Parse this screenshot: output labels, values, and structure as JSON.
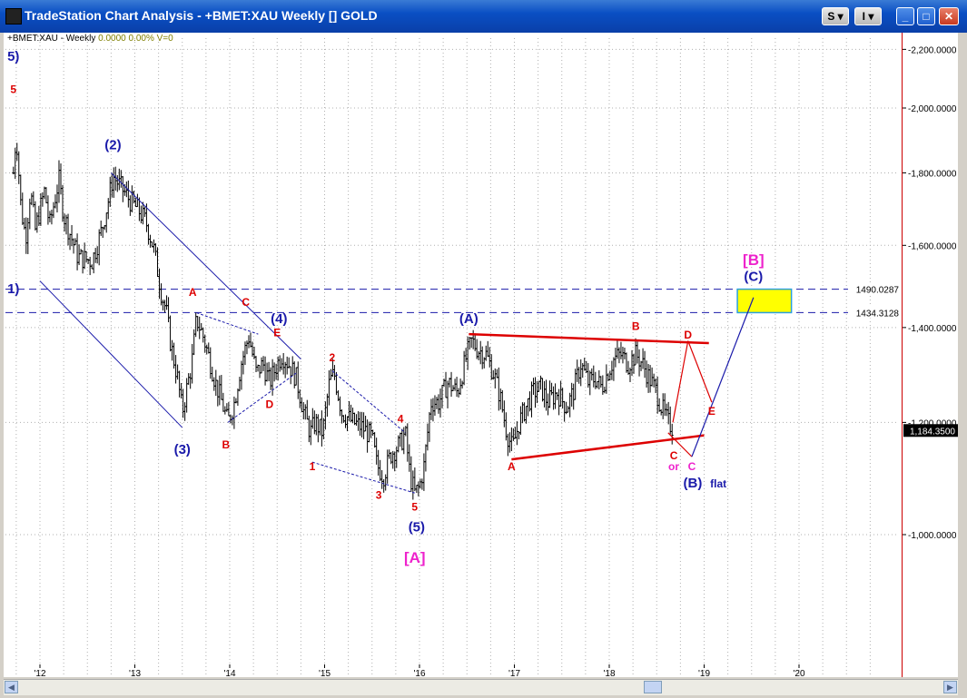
{
  "window": {
    "title": "TradeStation Chart Analysis - +BMET:XAU Weekly [] GOLD",
    "btn_s": "S",
    "btn_i": "I",
    "btn_min": "_",
    "btn_max": "□",
    "btn_close": "✕"
  },
  "header": {
    "symbol": "+BMET:XAU - Weekly",
    "value": "0.0000",
    "change": "0.00%",
    "volume": "V=0"
  },
  "colors": {
    "bars": "#000000",
    "wave_blue": "#1a1aaa",
    "wave_red": "#dd0000",
    "wave_magenta": "#ee22cc",
    "target_box": "#ffff00",
    "target_border": "#2a9fe0"
  },
  "chart_data": {
    "type": "ohlc-bar",
    "interval": "weekly",
    "x_ticks": [
      "'12",
      "'13",
      "'14",
      "'15",
      "'16",
      "'17",
      "'18",
      "'19",
      "'20"
    ],
    "y_ticks": [
      "2,200.0000",
      "2,000.0000",
      "1,800.0000",
      "1,600.0000",
      "1,400.0000",
      "1,200.0000",
      "1,000.0000"
    ],
    "y_tick_values": [
      2200,
      2000,
      1800,
      1600,
      1400,
      1200,
      1000
    ],
    "ylim": [
      840,
      2300
    ],
    "y_scale": "log",
    "last_price": "1,184.3500",
    "last_price_value": 1184.35,
    "price_path": [
      [
        2011.72,
        1800
      ],
      [
        2011.75,
        1920
      ],
      [
        2011.8,
        1700
      ],
      [
        2011.85,
        1620
      ],
      [
        2011.9,
        1750
      ],
      [
        2011.95,
        1640
      ],
      [
        2012.05,
        1750
      ],
      [
        2012.1,
        1650
      ],
      [
        2012.2,
        1780
      ],
      [
        2012.25,
        1680
      ],
      [
        2012.4,
        1570
      ],
      [
        2012.55,
        1560
      ],
      [
        2012.65,
        1640
      ],
      [
        2012.72,
        1720
      ],
      [
        2012.77,
        1790
      ],
      [
        2012.85,
        1760
      ],
      [
        2012.95,
        1720
      ],
      [
        2013.05,
        1690
      ],
      [
        2013.12,
        1660
      ],
      [
        2013.2,
        1590
      ],
      [
        2013.28,
        1480
      ],
      [
        2013.33,
        1440
      ],
      [
        2013.38,
        1360
      ],
      [
        2013.45,
        1290
      ],
      [
        2013.5,
        1220
      ],
      [
        2013.55,
        1270
      ],
      [
        2013.6,
        1320
      ],
      [
        2013.65,
        1420
      ],
      [
        2013.72,
        1380
      ],
      [
        2013.8,
        1320
      ],
      [
        2013.85,
        1280
      ],
      [
        2013.9,
        1250
      ],
      [
        2013.98,
        1200
      ],
      [
        2014.05,
        1240
      ],
      [
        2014.12,
        1320
      ],
      [
        2014.2,
        1380
      ],
      [
        2014.28,
        1300
      ],
      [
        2014.35,
        1320
      ],
      [
        2014.42,
        1280
      ],
      [
        2014.5,
        1320
      ],
      [
        2014.55,
        1340
      ],
      [
        2014.62,
        1320
      ],
      [
        2014.7,
        1290
      ],
      [
        2014.78,
        1220
      ],
      [
        2014.85,
        1180
      ],
      [
        2014.9,
        1200
      ],
      [
        2014.98,
        1180
      ],
      [
        2015.05,
        1280
      ],
      [
        2015.1,
        1300
      ],
      [
        2015.18,
        1220
      ],
      [
        2015.3,
        1200
      ],
      [
        2015.4,
        1190
      ],
      [
        2015.5,
        1170
      ],
      [
        2015.55,
        1120
      ],
      [
        2015.62,
        1100
      ],
      [
        2015.7,
        1140
      ],
      [
        2015.8,
        1160
      ],
      [
        2015.85,
        1180
      ],
      [
        2015.9,
        1100
      ],
      [
        2015.95,
        1070
      ],
      [
        2016.0,
        1080
      ],
      [
        2016.05,
        1120
      ],
      [
        2016.12,
        1240
      ],
      [
        2016.2,
        1240
      ],
      [
        2016.3,
        1280
      ],
      [
        2016.4,
        1260
      ],
      [
        2016.5,
        1340
      ],
      [
        2016.55,
        1370
      ],
      [
        2016.62,
        1350
      ],
      [
        2016.7,
        1340
      ],
      [
        2016.78,
        1300
      ],
      [
        2016.85,
        1250
      ],
      [
        2016.92,
        1180
      ],
      [
        2016.98,
        1150
      ],
      [
        2017.05,
        1200
      ],
      [
        2017.12,
        1230
      ],
      [
        2017.2,
        1260
      ],
      [
        2017.28,
        1270
      ],
      [
        2017.35,
        1240
      ],
      [
        2017.45,
        1260
      ],
      [
        2017.55,
        1230
      ],
      [
        2017.62,
        1260
      ],
      [
        2017.7,
        1320
      ],
      [
        2017.78,
        1280
      ],
      [
        2017.85,
        1290
      ],
      [
        2017.92,
        1270
      ],
      [
        2017.98,
        1300
      ],
      [
        2018.05,
        1330
      ],
      [
        2018.12,
        1340
      ],
      [
        2018.2,
        1320
      ],
      [
        2018.28,
        1340
      ],
      [
        2018.35,
        1320
      ],
      [
        2018.42,
        1290
      ],
      [
        2018.5,
        1260
      ],
      [
        2018.55,
        1230
      ],
      [
        2018.62,
        1200
      ],
      [
        2018.67,
        1190
      ]
    ],
    "horizontal_levels": [
      {
        "label": "1490.0287",
        "value": 1490.0287
      },
      {
        "label": "1434.3128",
        "value": 1434.3128
      }
    ],
    "annotations": [
      {
        "text": "(2)",
        "color": "blue",
        "x": 2012.77,
        "y": 1870
      },
      {
        "text": "(3)",
        "color": "blue",
        "x": 2013.5,
        "y": 1140
      },
      {
        "text": "(4)",
        "color": "blue",
        "x": 2014.52,
        "y": 1410
      },
      {
        "text": "(5)",
        "color": "blue",
        "x": 2015.97,
        "y": 1005
      },
      {
        "text": "(A)",
        "color": "blue",
        "x": 2016.52,
        "y": 1410
      },
      {
        "text": "(B)",
        "color": "blue",
        "x": 2018.88,
        "y": 1080
      },
      {
        "text": "(C)",
        "color": "blue",
        "x": 2019.52,
        "y": 1510
      },
      {
        "text": "5)",
        "color": "blue",
        "x": 2011.72,
        "y": 2160
      },
      {
        "text": "1)",
        "color": "blue",
        "x": 2011.72,
        "y": 1480
      },
      {
        "text": "5",
        "color": "red",
        "x": 2011.72,
        "y": 2050
      },
      {
        "text": "A",
        "color": "red",
        "x": 2013.61,
        "y": 1474
      },
      {
        "text": "C",
        "color": "red",
        "x": 2014.17,
        "y": 1450
      },
      {
        "text": "E",
        "color": "red",
        "x": 2014.5,
        "y": 1380
      },
      {
        "text": "D",
        "color": "red",
        "x": 2014.42,
        "y": 1228
      },
      {
        "text": "B",
        "color": "red",
        "x": 2013.96,
        "y": 1150
      },
      {
        "text": "2",
        "color": "red",
        "x": 2015.08,
        "y": 1325
      },
      {
        "text": "4",
        "color": "red",
        "x": 2015.8,
        "y": 1200
      },
      {
        "text": "1",
        "color": "red",
        "x": 2014.87,
        "y": 1110
      },
      {
        "text": "3",
        "color": "red",
        "x": 2015.57,
        "y": 1060
      },
      {
        "text": "5",
        "color": "red",
        "x": 2015.95,
        "y": 1040
      },
      {
        "text": "A",
        "color": "red",
        "x": 2016.97,
        "y": 1110
      },
      {
        "text": "B",
        "color": "red",
        "x": 2018.28,
        "y": 1395
      },
      {
        "text": "D",
        "color": "red",
        "x": 2018.83,
        "y": 1375
      },
      {
        "text": "E",
        "color": "red",
        "x": 2019.08,
        "y": 1215
      },
      {
        "text": "C",
        "color": "red",
        "x": 2018.68,
        "y": 1130
      },
      {
        "text": "or",
        "color": "magenta",
        "x": 2018.68,
        "y": 1110
      },
      {
        "text": "C",
        "color": "magenta",
        "x": 2018.87,
        "y": 1110
      },
      {
        "text": "flat",
        "color": "blue",
        "x": 2019.15,
        "y": 1080
      },
      {
        "text": "[A]",
        "color": "magenta",
        "x": 2015.95,
        "y": 955
      },
      {
        "text": "[B]",
        "color": "magenta",
        "x": 2019.52,
        "y": 1550
      }
    ]
  }
}
